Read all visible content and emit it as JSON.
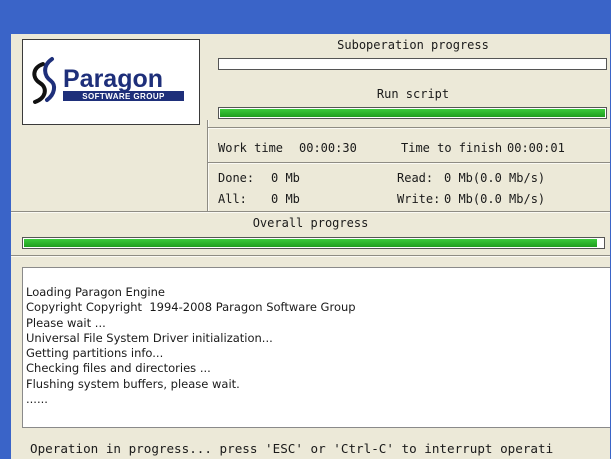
{
  "logo": {
    "brand": "Paragon",
    "tagline": "SOFTWARE GROUP"
  },
  "suboperation": {
    "title": "Suboperation progress",
    "progress": 0
  },
  "step": {
    "title": "Run script",
    "progress": 1.0
  },
  "times": {
    "work_label": "Work time",
    "work_value": "00:00:30",
    "finish_label": "Time to finish",
    "finish_value": "00:00:01"
  },
  "stats": {
    "done_label": "Done:",
    "done_value": "0 Mb",
    "read_label": "Read:",
    "read_value": "0 Mb(0.0 Mb/s)",
    "all_label": "All:",
    "all_value": "0 Mb",
    "write_label": "Write:",
    "write_value": "0 Mb(0.0 Mb/s)"
  },
  "overall": {
    "title": "Overall progress",
    "progress": 0.99
  },
  "log_lines": [
    "Loading Paragon Engine",
    "Copyright Copyright  1994-2008 Paragon Software Group",
    "Please wait ...",
    "Universal File System Driver initialization...",
    "Getting partitions info...",
    "Checking files and directories ...",
    "Flushing system buffers, please wait.",
    "......"
  ],
  "status": "Operation in progress... press 'ESC' or 'Ctrl-C' to interrupt operati",
  "colors": {
    "title_bar": "#3a64c8",
    "panel": "#ece9d8",
    "progress_fill": "#28b628",
    "logo_blue": "#1e2f7a"
  }
}
